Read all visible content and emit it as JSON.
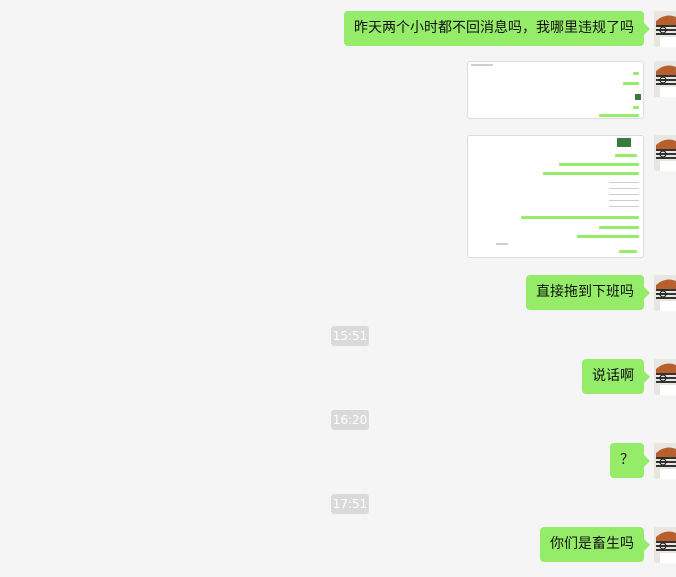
{
  "messages": [
    {
      "type": "text",
      "text": "昨天两个小时都不回消息吗，我哪里违规了吗"
    },
    {
      "type": "image",
      "label": "screenshot-1"
    },
    {
      "type": "image",
      "label": "screenshot-2"
    },
    {
      "type": "text",
      "text": "直接拖到下班吗"
    },
    {
      "type": "time",
      "text": "15:51"
    },
    {
      "type": "text",
      "text": "说话啊"
    },
    {
      "type": "time",
      "text": "16:20"
    },
    {
      "type": "text",
      "text": "？"
    },
    {
      "type": "time",
      "text": "17:51"
    },
    {
      "type": "text",
      "text": "你们是畜生吗"
    }
  ],
  "colors": {
    "bubble": "#95ec69",
    "background": "#f5f5f5",
    "timestamp_bg": "#dadada"
  }
}
